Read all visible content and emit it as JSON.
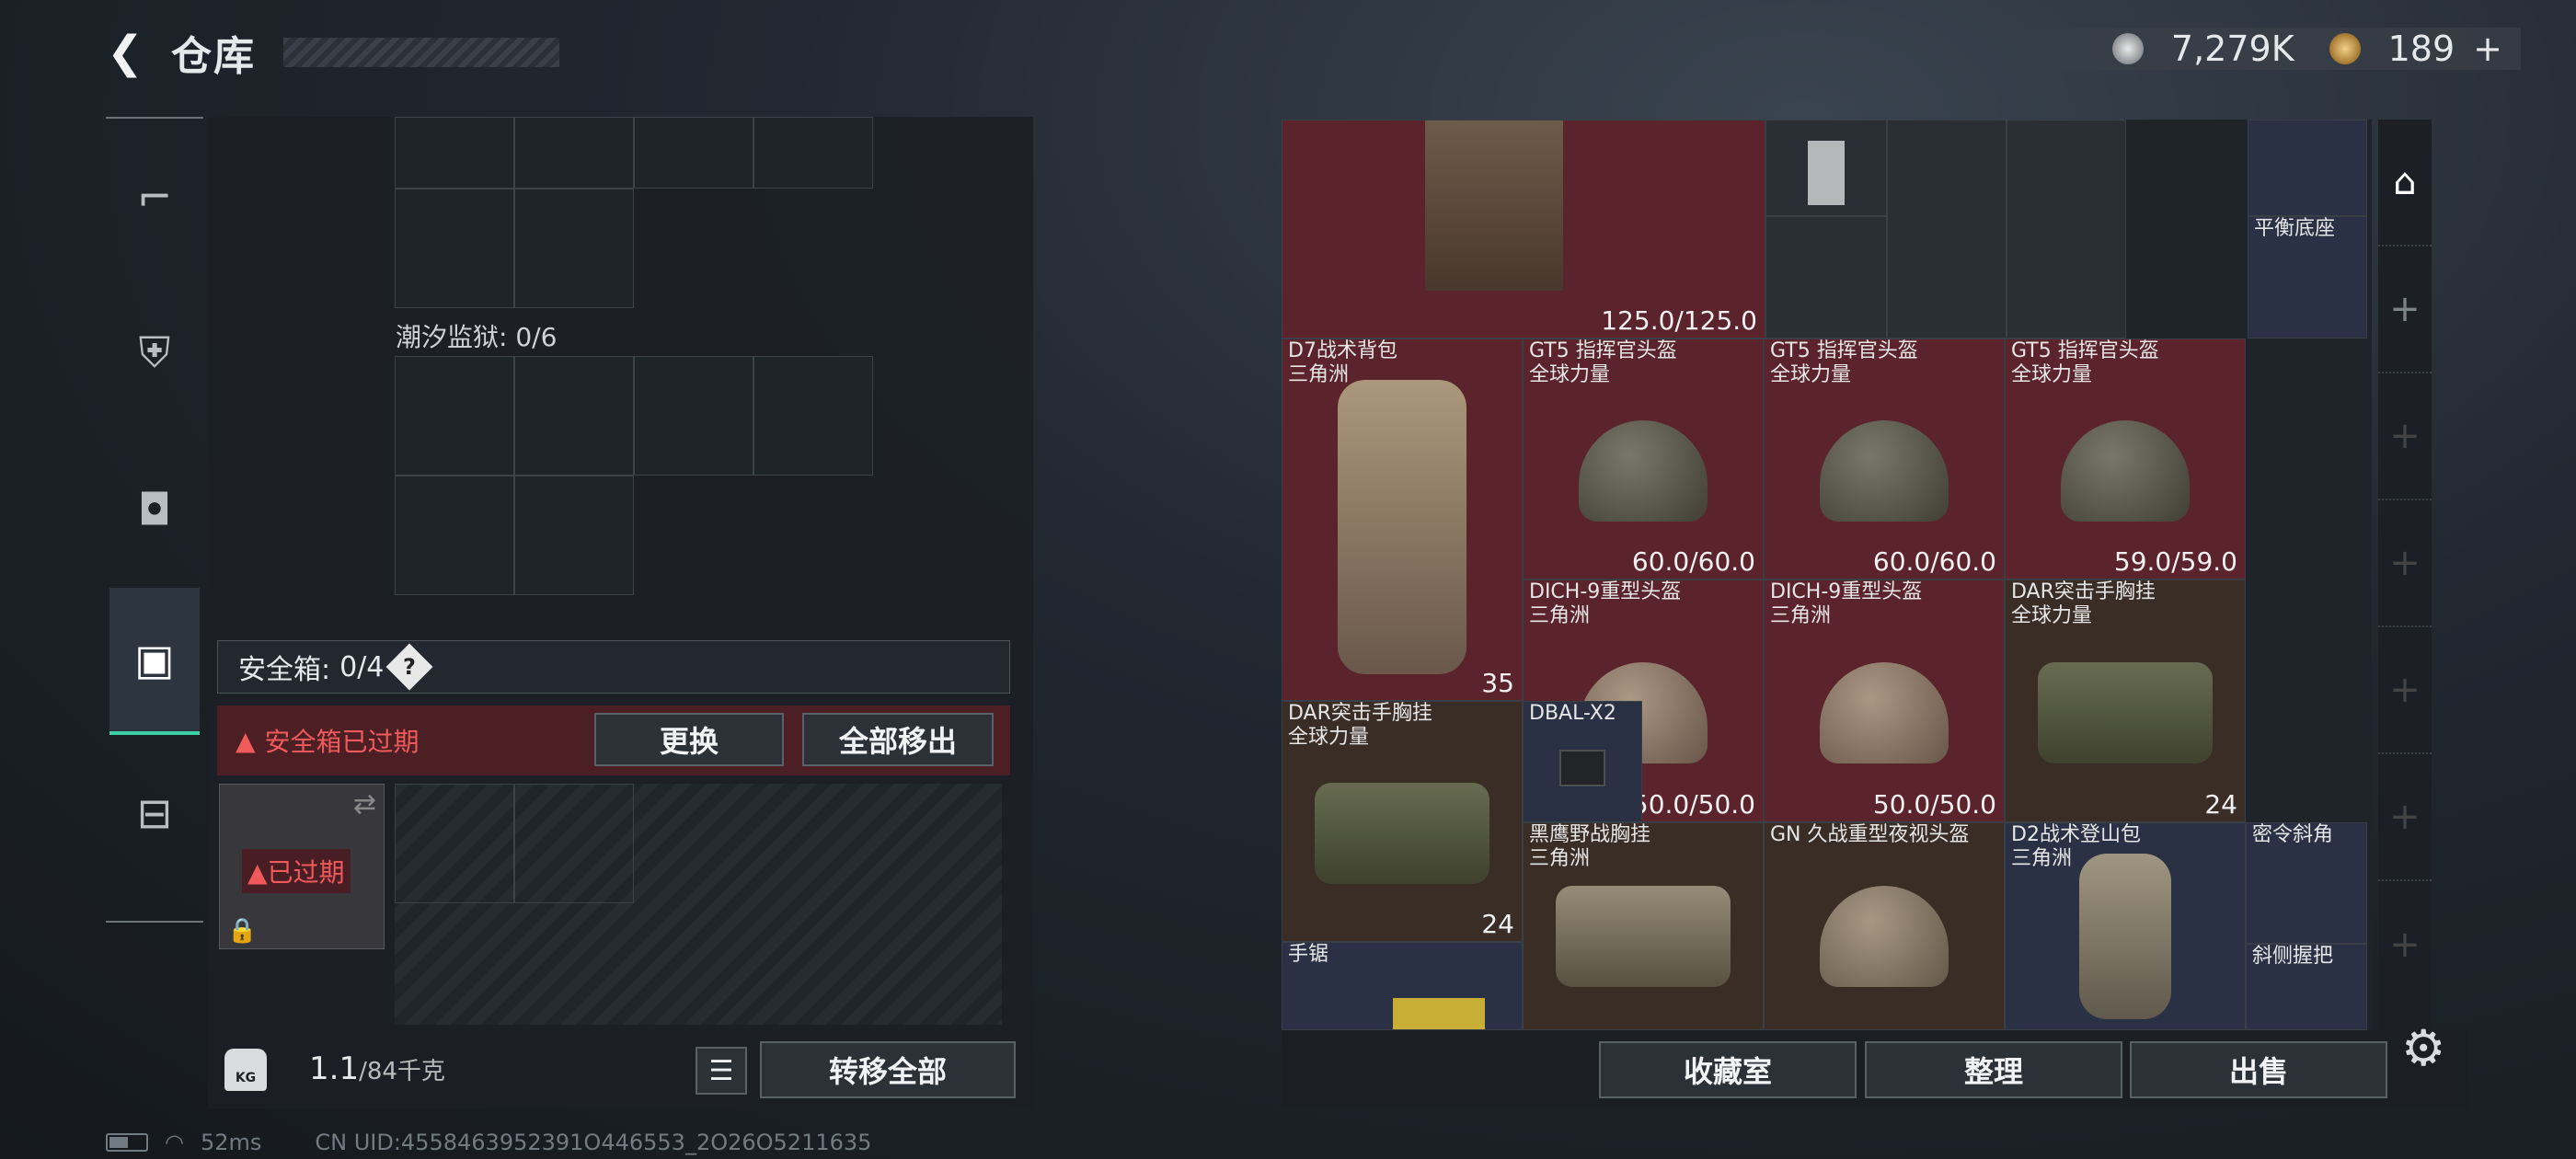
{
  "header": {
    "back_icon": "back-arrow-icon",
    "title": "仓库",
    "currency": {
      "silver": "7,279K",
      "gold": "189",
      "gold_plus": "+"
    }
  },
  "left_nav": [
    {
      "icon": "pistol-icon"
    },
    {
      "icon": "armor-vest-icon"
    },
    {
      "icon": "backpack-icon"
    },
    {
      "icon": "safe-box-icon",
      "active": true
    },
    {
      "icon": "toolbox-icon"
    }
  ],
  "left_panel": {
    "tidal_prison_label": "潮汐监狱: 0/6",
    "safebox_label": "安全箱:",
    "safebox_value": "0/4",
    "help": "?",
    "expired_warning": "安全箱已过期",
    "replace_button": "更换",
    "move_all_button": "全部移出",
    "box_tag": "已过期",
    "weight_value": "1.1",
    "weight_max": "/84千克",
    "kg_icon_text": "KG",
    "transfer_all_button": "转移全部"
  },
  "items": [
    {
      "name": "",
      "value": "125.0/125.0"
    },
    {
      "name": "平衡底座",
      "value": ""
    },
    {
      "name": "D7战术背包\n三角洲",
      "value": "35"
    },
    {
      "name": "GT5 指挥官头盔\n全球力量",
      "value": "60.0/60.0"
    },
    {
      "name": "GT5 指挥官头盔\n全球力量",
      "value": "60.0/60.0"
    },
    {
      "name": "GT5 指挥官头盔\n全球力量",
      "value": "59.0/59.0"
    },
    {
      "name": "DICH-9重型头盔\n三角洲",
      "value": "50.0/50.0"
    },
    {
      "name": "DICH-9重型头盔\n三角洲",
      "value": "50.0/50.0"
    },
    {
      "name": "DAR突击手胸挂\n全球力量",
      "value": "24"
    },
    {
      "name": "DAR突击手胸挂\n全球力量",
      "value": "24"
    },
    {
      "name": "DBAL-X2",
      "value": ""
    },
    {
      "name": "黑鹰野战胸挂\n三角洲",
      "value": ""
    },
    {
      "name": "GN 久战重型夜视头盔",
      "value": ""
    },
    {
      "name": "D2战术登山包\n三角洲",
      "value": ""
    },
    {
      "name": "密令斜角",
      "value": ""
    },
    {
      "name": "斜侧握把",
      "value": ""
    },
    {
      "name": "手锯",
      "value": ""
    }
  ],
  "right_buttons": {
    "collection": "收藏室",
    "sort": "整理",
    "sell": "出售"
  },
  "footer": {
    "ping": "52ms",
    "uid": "CN UID:4558463952391O446553_2O26O5211635"
  }
}
